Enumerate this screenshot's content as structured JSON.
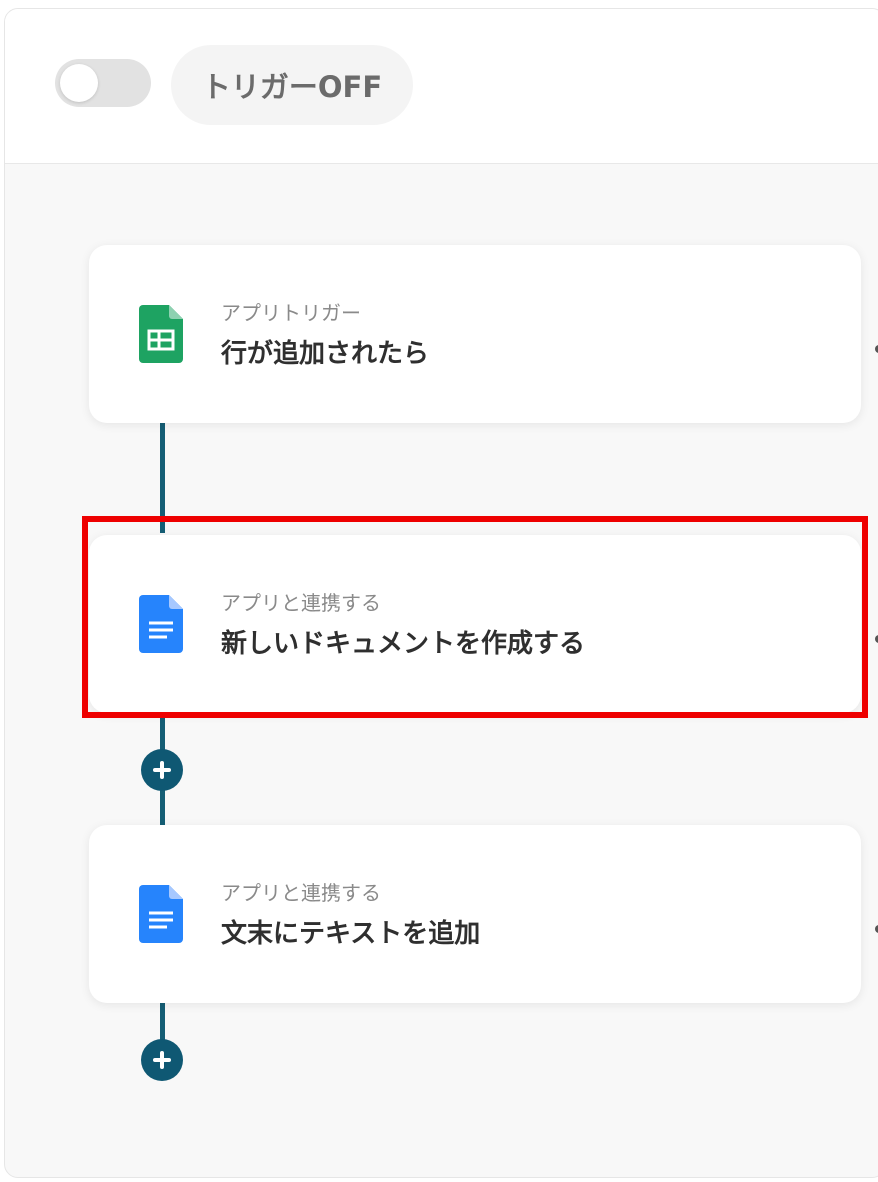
{
  "header": {
    "trigger_status_label": "トリガーOFF",
    "trigger_enabled": false
  },
  "flow": {
    "steps": [
      {
        "category": "アプリトリガー",
        "title": "行が追加されたら",
        "icon": "google-sheets-icon",
        "color": "#1ea362"
      },
      {
        "category": "アプリと連携する",
        "title": "新しいドキュメントを作成する",
        "icon": "google-docs-icon",
        "color": "#2684fc",
        "highlighted": true
      },
      {
        "category": "アプリと連携する",
        "title": "文末にテキストを追加",
        "icon": "google-docs-icon",
        "color": "#2684fc"
      }
    ]
  },
  "colors": {
    "connector": "#155e75",
    "highlight": "#ee0000"
  }
}
